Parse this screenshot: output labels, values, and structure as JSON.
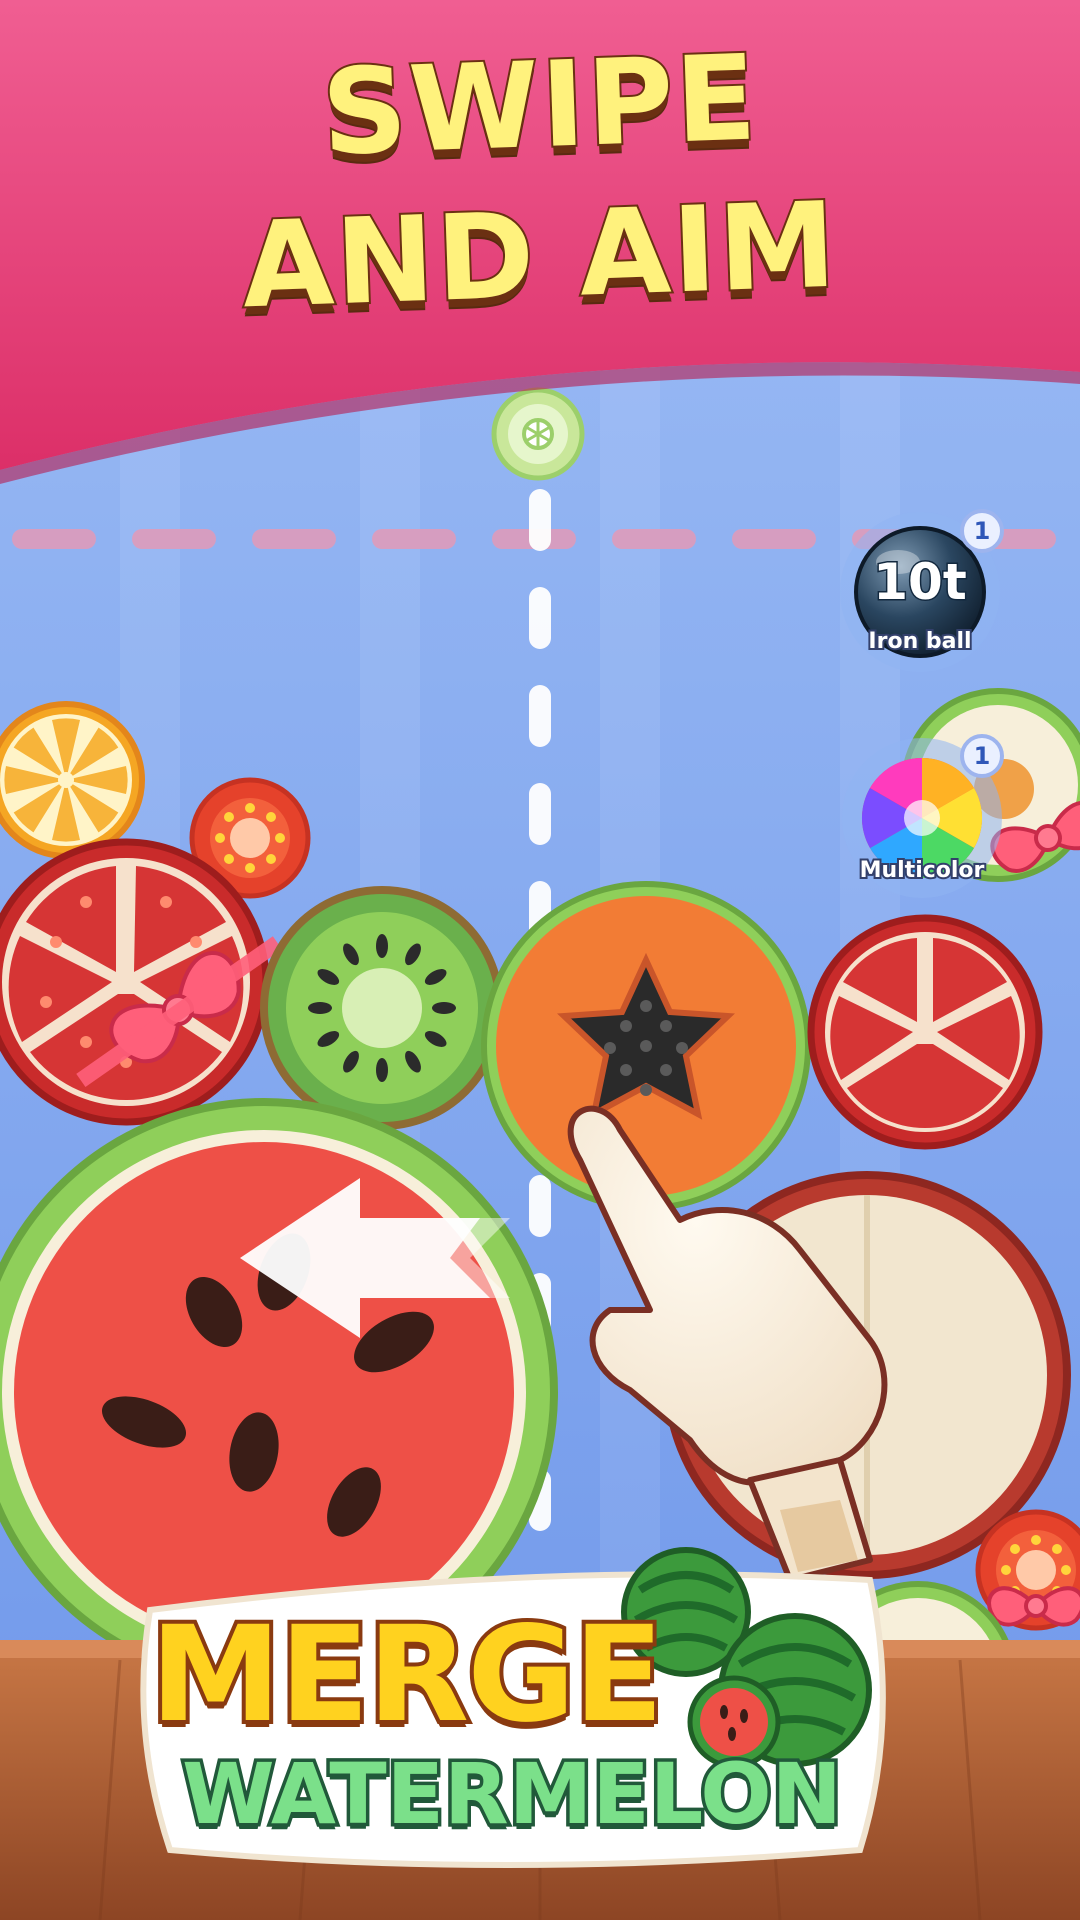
{
  "banner": {
    "line1": "SWIPE",
    "line2": "AND AIM",
    "color": "#e73e76"
  },
  "powerups": [
    {
      "name": "Iron ball",
      "icon": "iron-ball-icon",
      "icon_text": "10t",
      "count": "1"
    },
    {
      "name": "Multicolor",
      "icon": "multicolor-ball-icon",
      "count": "1"
    }
  ],
  "logo": {
    "line1": "MERGE",
    "line2": "WATERMELON"
  },
  "colors": {
    "background": "#7fa9f0",
    "floor": "#b8643a",
    "limit_line": "#e39ab8"
  }
}
